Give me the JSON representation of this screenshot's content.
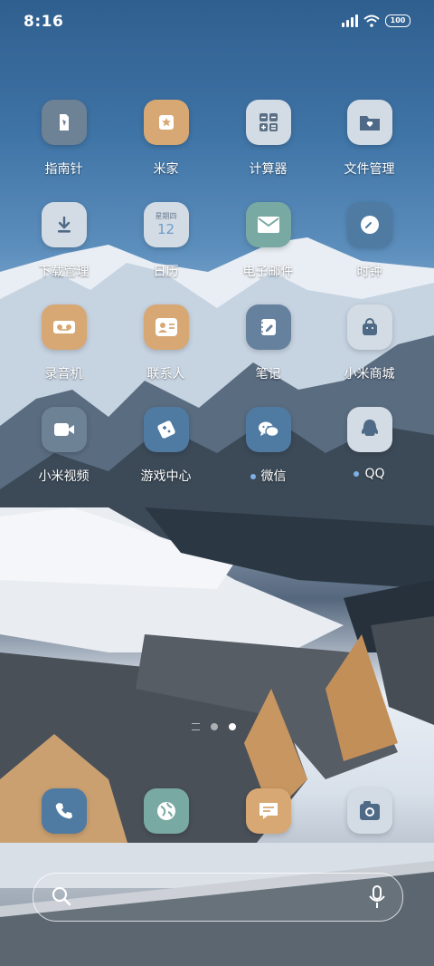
{
  "status_bar": {
    "time": "8:16",
    "battery": "100"
  },
  "apps": [
    {
      "label": "指南针",
      "icon": "compass-icon",
      "color": "#6e8296"
    },
    {
      "label": "米家",
      "icon": "mijia-icon",
      "color": "#d8a874"
    },
    {
      "label": "计算器",
      "icon": "calculator-icon",
      "color": "#d3dbe4"
    },
    {
      "label": "文件管理",
      "icon": "folder-icon",
      "color": "#d3dbe4"
    },
    {
      "label": "下载管理",
      "icon": "download-icon",
      "color": "#d3dbe4"
    },
    {
      "label": "日历",
      "icon": "calendar-icon",
      "color": "#d3dbe4",
      "weekday": "星期四",
      "day": "12"
    },
    {
      "label": "电子邮件",
      "icon": "mail-icon",
      "color": "#78a9a2"
    },
    {
      "label": "时钟",
      "icon": "clock-icon",
      "color": "#4f7aa2"
    },
    {
      "label": "录音机",
      "icon": "recorder-icon",
      "color": "#d8a874"
    },
    {
      "label": "联系人",
      "icon": "contacts-icon",
      "color": "#d8a874"
    },
    {
      "label": "笔记",
      "icon": "notes-icon",
      "color": "#65819d"
    },
    {
      "label": "小米商城",
      "icon": "shopping-bag-icon",
      "color": "#d3dbe4"
    },
    {
      "label": "小米视频",
      "icon": "video-icon",
      "color": "#6e8296"
    },
    {
      "label": "游戏中心",
      "icon": "game-center-icon",
      "color": "#4f7aa2"
    },
    {
      "label": "微信",
      "icon": "wechat-icon",
      "color": "#4f7aa2",
      "new_badge": true
    },
    {
      "label": "QQ",
      "icon": "qq-icon",
      "color": "#d3dbe4",
      "new_badge": true
    }
  ],
  "dock": [
    {
      "icon": "phone-icon",
      "color": "#4f7aa2"
    },
    {
      "icon": "browser-icon",
      "color": "#78a9a2"
    },
    {
      "icon": "messages-icon",
      "color": "#d8a874"
    },
    {
      "icon": "camera-icon",
      "color": "#d3dbe4"
    }
  ],
  "pager": {
    "pages": 2,
    "current": 2
  }
}
